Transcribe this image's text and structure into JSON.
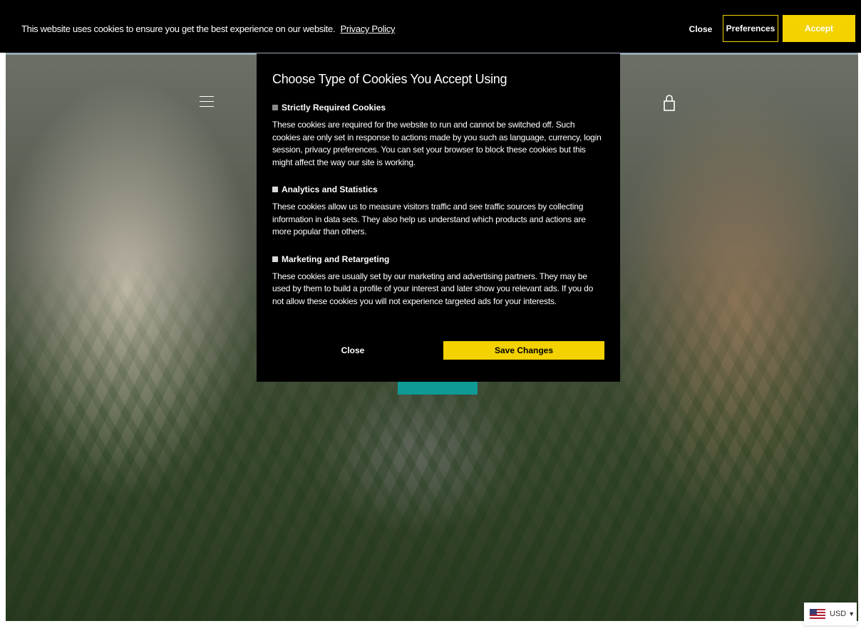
{
  "cookie_bar": {
    "message": "This website uses cookies to ensure you get the best experience on our website.",
    "privacy_link": "Privacy Policy",
    "close_label": "Close",
    "preferences_label": "Preferences",
    "accept_label": "Accept"
  },
  "modal": {
    "title": "Choose Type of Cookies You Accept Using",
    "options": [
      {
        "label": "Strictly Required Cookies",
        "checked": true,
        "disabled": true,
        "description": "These cookies are required for the website to run and cannot be switched off. Such cookies are only set in response to actions made by you such as language, currency, login session, privacy preferences. You can set your browser to block these cookies but this might affect the way our site is working."
      },
      {
        "label": "Analytics and Statistics",
        "checked": false,
        "disabled": false,
        "description": "These cookies allow us to measure visitors traffic and see traffic sources by collecting information in data sets. They also help us understand which products and actions are more popular than others."
      },
      {
        "label": "Marketing and Retargeting",
        "checked": false,
        "disabled": false,
        "description": "These cookies are usually set by our marketing and advertising partners. They may be used by them to build a profile of your interest and later show you relevant ads. If you do not allow these cookies you will not experience targeted ads for your interests."
      }
    ],
    "close_label": "Close",
    "save_label": "Save Changes"
  },
  "currency": {
    "code": "USD",
    "flag_icon": "us-flag-icon"
  },
  "colors": {
    "accent": "#f3d200",
    "teal": "#0f9a96",
    "bar_bg": "#000000"
  }
}
